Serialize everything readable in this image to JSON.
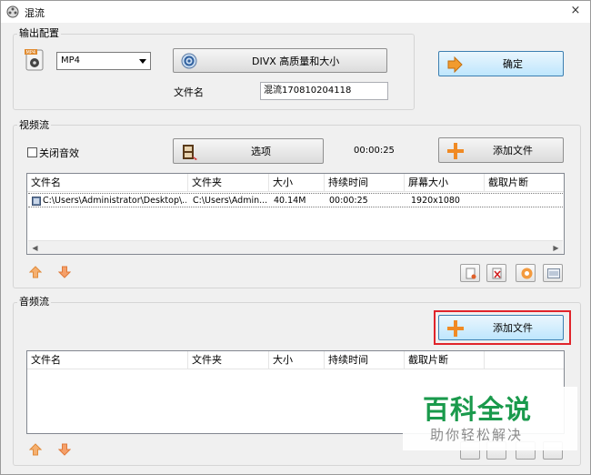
{
  "window": {
    "title": "混流",
    "close_glyph": "×"
  },
  "output_group": {
    "legend": "输出配置",
    "format_value": "MP4",
    "quality_button": "DIVX 高质量和大小",
    "confirm_button": "确定",
    "filename_label": "文件名",
    "filename_value": "混流170810204118"
  },
  "video_group": {
    "legend": "视频流",
    "mute_label": "关闭音效",
    "options_button": "选项",
    "duration": "00:00:25",
    "add_file_button": "添加文件",
    "columns": [
      "文件名",
      "文件夹",
      "大小",
      "持续时间",
      "屏幕大小",
      "截取片断"
    ],
    "rows": [
      {
        "name": "C:\\Users\\Administrator\\Desktop\\...",
        "folder": "C:\\Users\\Admin...",
        "size": "40.14M",
        "duration": "00:00:25",
        "resolution": "1920x1080",
        "clip": ""
      }
    ]
  },
  "audio_group": {
    "legend": "音频流",
    "add_file_button": "添加文件",
    "columns": [
      "文件名",
      "文件夹",
      "大小",
      "持续时间",
      "截取片断"
    ]
  },
  "watermark": {
    "title": "百科全说",
    "subtitle": "助你轻松解决"
  },
  "colors": {
    "highlight": "#e0242b",
    "watermark_green": "#1a9a4c",
    "up_arrow": "#f5a04a",
    "down_arrow": "#f07f40"
  }
}
